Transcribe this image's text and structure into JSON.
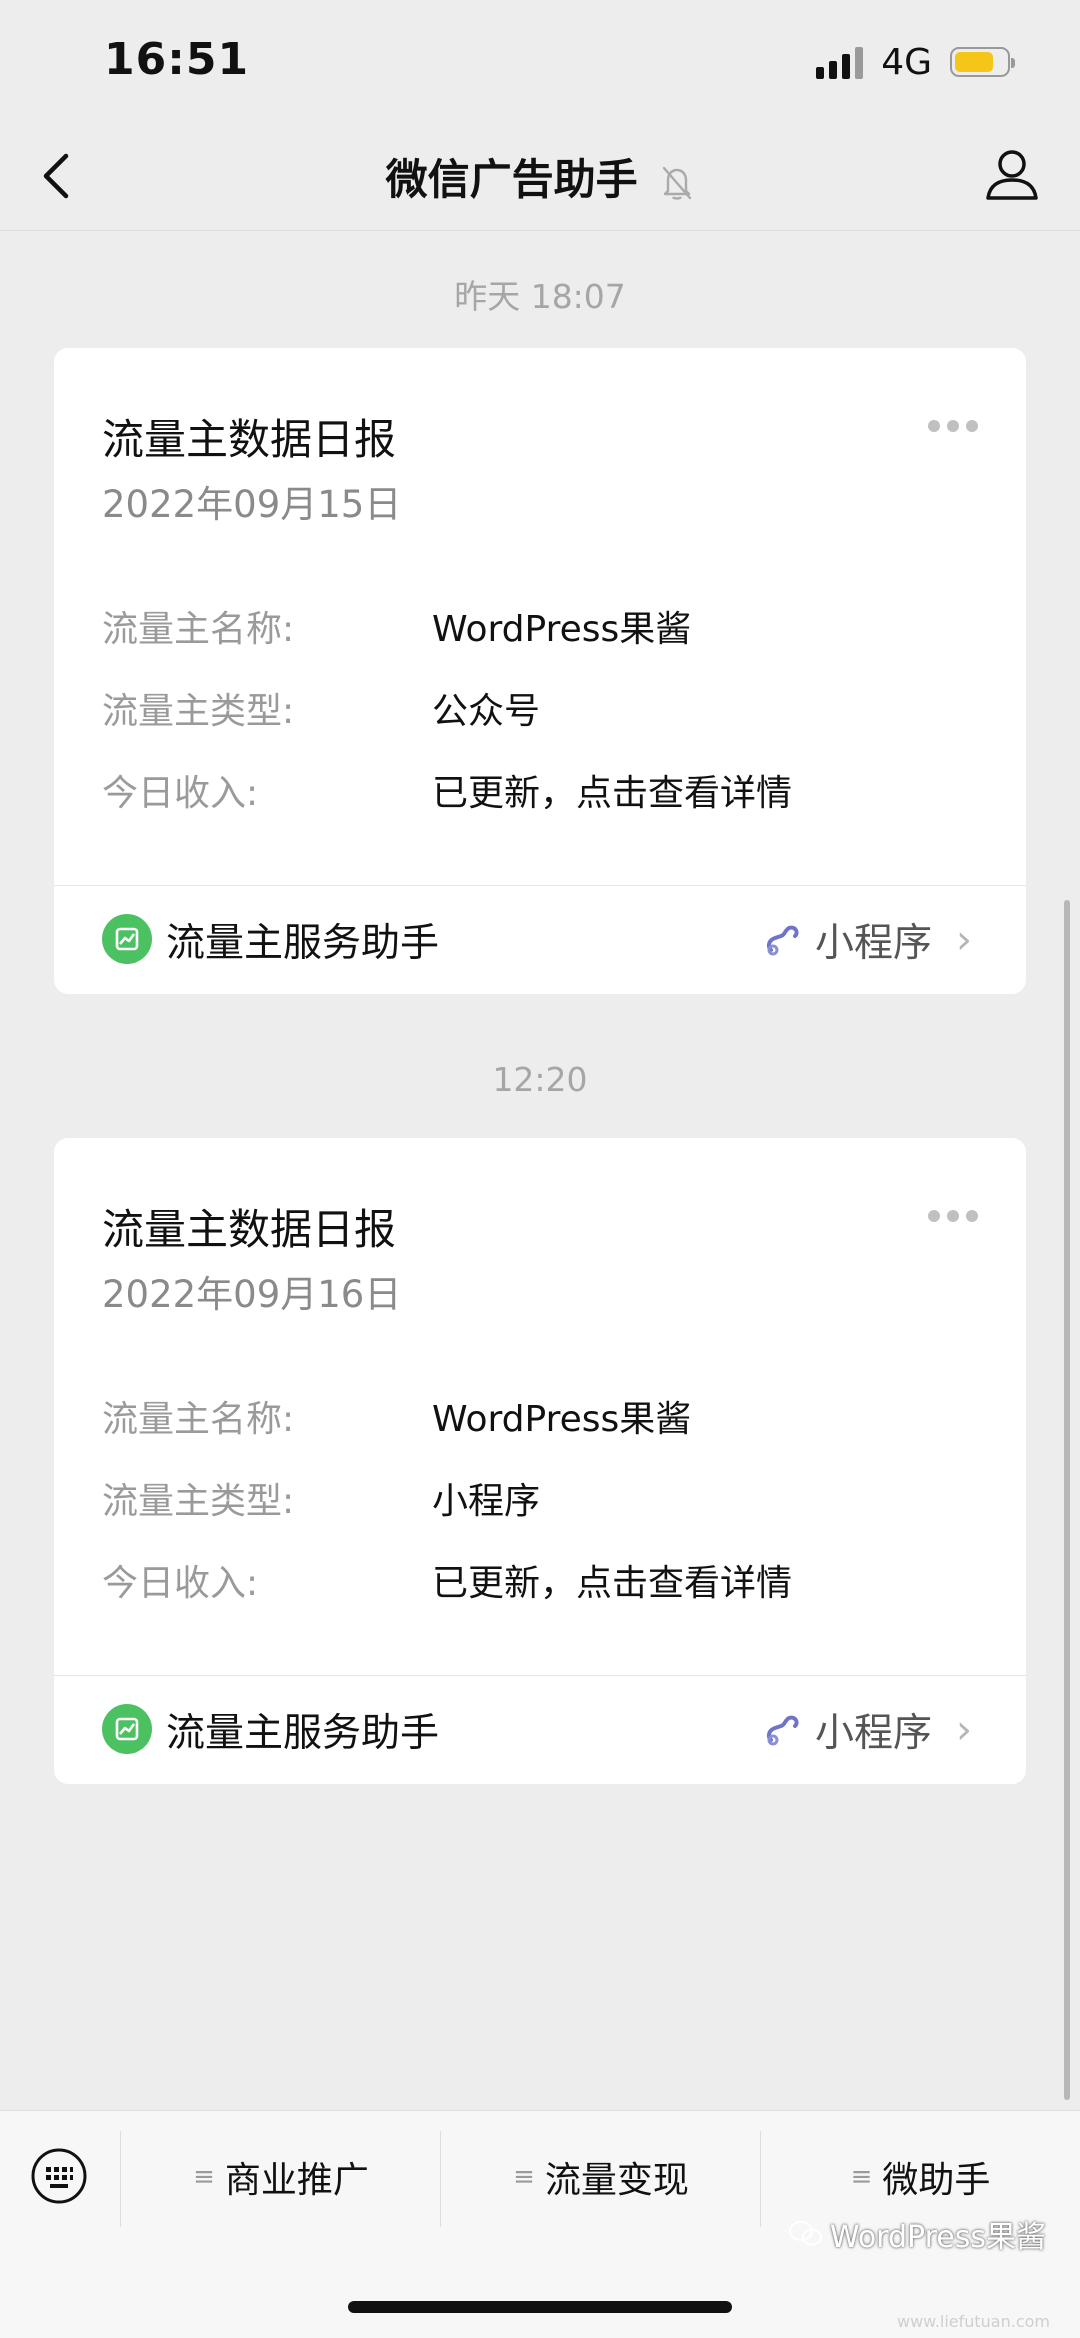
{
  "status": {
    "time": "16:51",
    "network": "4G",
    "battery_color": "#f5c518"
  },
  "nav": {
    "title": "微信广告助手",
    "back_icon": "chevron-left-icon",
    "mute_icon": "bell-off-icon",
    "profile_icon": "person-icon"
  },
  "messages": [
    {
      "timestamp": "昨天 18:07",
      "title": "流量主数据日报",
      "date": "2022年09月15日",
      "rows": [
        {
          "label": "流量主名称:",
          "value": "WordPress果酱"
        },
        {
          "label": "流量主类型:",
          "value": "公众号"
        },
        {
          "label": "今日收入:",
          "value": "已更新，点击查看详情"
        }
      ],
      "footer": {
        "app_name": "流量主服务助手",
        "tag": "小程序"
      }
    },
    {
      "timestamp": "12:20",
      "title": "流量主数据日报",
      "date": "2022年09月16日",
      "rows": [
        {
          "label": "流量主名称:",
          "value": "WordPress果酱"
        },
        {
          "label": "流量主类型:",
          "value": "小程序"
        },
        {
          "label": "今日收入:",
          "value": "已更新，点击查看详情"
        }
      ],
      "footer": {
        "app_name": "流量主服务助手",
        "tag": "小程序"
      }
    }
  ],
  "menu": {
    "keyboard_icon": "keyboard-icon",
    "items": [
      {
        "label": "商业推广"
      },
      {
        "label": "流量变现"
      },
      {
        "label": "微助手"
      }
    ]
  },
  "watermark": {
    "text": "WordPress果酱",
    "sub": "www.liefutuan.com"
  }
}
